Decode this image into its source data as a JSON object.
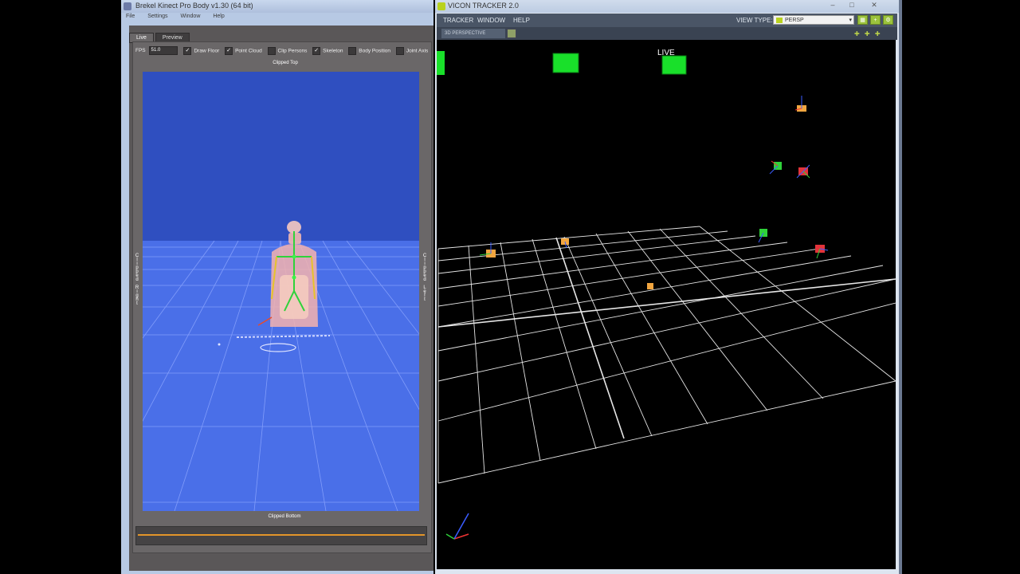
{
  "brekel": {
    "title": "Brekel Kinect Pro Body v1.30 (64 bit)",
    "menu": [
      "File",
      "Settings",
      "Window",
      "Help"
    ],
    "tabs": [
      "Live",
      "Preview"
    ],
    "active_tab": "Live",
    "toolbar": {
      "fps_label": "FPS",
      "fps_value": "51.0",
      "options": [
        {
          "label": "Draw Floor",
          "checked": true
        },
        {
          "label": "Point Cloud",
          "checked": true
        },
        {
          "label": "Clip Persons",
          "checked": false
        },
        {
          "label": "Skeleton",
          "checked": true
        },
        {
          "label": "Body Position",
          "checked": false
        },
        {
          "label": "Joint Axis",
          "checked": false
        }
      ]
    },
    "clip_labels": {
      "top": "Clipped Top",
      "bottom": "Clipped Bottom",
      "right": "Clipped Right",
      "left": "Clipped Left"
    },
    "colors": {
      "viewport_floor": "#4a6fe8",
      "viewport_sky": "#2f4fc0",
      "timeline": "#e2952a"
    }
  },
  "vicon": {
    "title": "VICON TRACKER 2.0",
    "menu": [
      "TRACKER",
      "WINDOW",
      "HELP"
    ],
    "view_type_label": "VIEW TYPE:",
    "view_type_value": "PERSP",
    "subtab_label": "3D PERSPECTIVE",
    "live_label": "LIVE",
    "window_buttons": [
      "–",
      "□",
      "✕"
    ],
    "colors": {
      "camera_green": "#19e02a",
      "grid": "#ffffff",
      "accent": "#b9d21f"
    }
  }
}
